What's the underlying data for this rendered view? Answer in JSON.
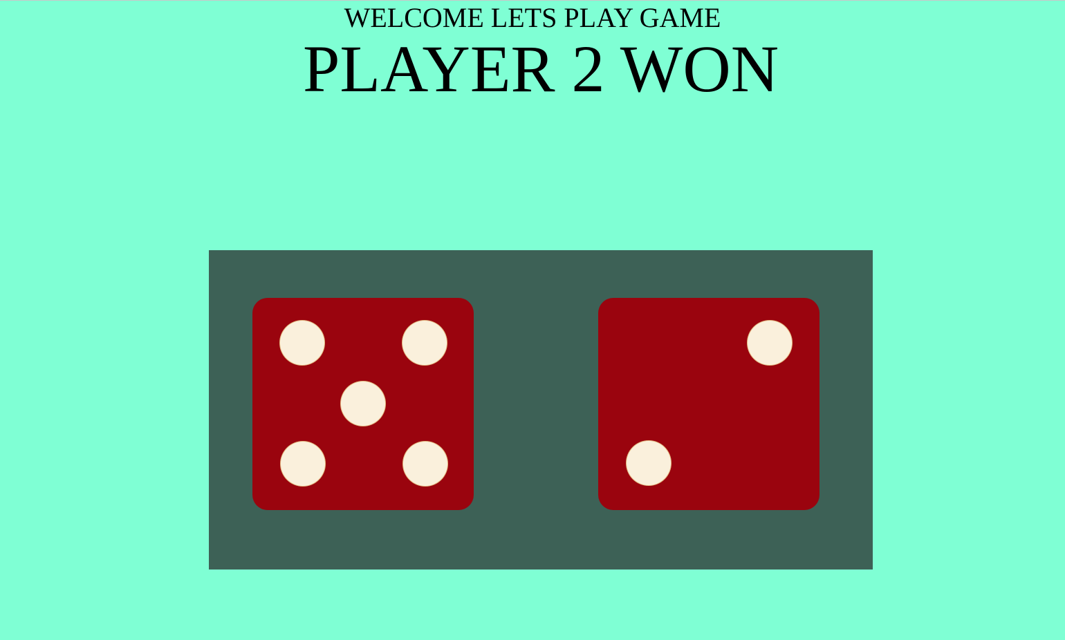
{
  "header": {
    "welcome_text": "WELCOME LETS PLAY GAME",
    "result_text": "PLAYER 2 WON"
  },
  "dice": [
    {
      "label": "die-1",
      "value": 5
    },
    {
      "label": "die-2",
      "value": 2
    }
  ],
  "colors": {
    "background": "#7fffd4",
    "board": "#3d6156",
    "die": "#9a040e",
    "pip": "#faf0dc"
  }
}
